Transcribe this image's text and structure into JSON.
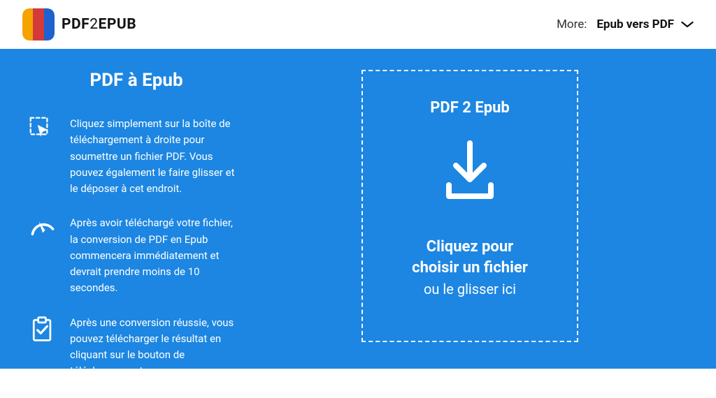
{
  "header": {
    "brand_prefix": "PDF",
    "brand_mid": "2",
    "brand_suffix": "EPUB",
    "more_label": "More:",
    "more_link": "Epub vers PDF"
  },
  "left": {
    "title": "PDF à Epub",
    "steps": [
      "Cliquez simplement sur la boîte de téléchargement à droite pour soumettre un fichier PDF. Vous pouvez également le faire glisser et le déposer à cet endroit.",
      "Après avoir téléchargé votre fichier, la conversion de PDF en Epub commencera immédiatement et devrait prendre moins de 10 secondes.",
      "Après une conversion réussie, vous pouvez télécharger le résultat en cliquant sur le bouton de téléchargement."
    ]
  },
  "dropzone": {
    "title": "PDF 2 Epub",
    "main_line1": "Cliquez pour",
    "main_line2": "choisir un fichier",
    "sub": "ou le glisser ici"
  }
}
